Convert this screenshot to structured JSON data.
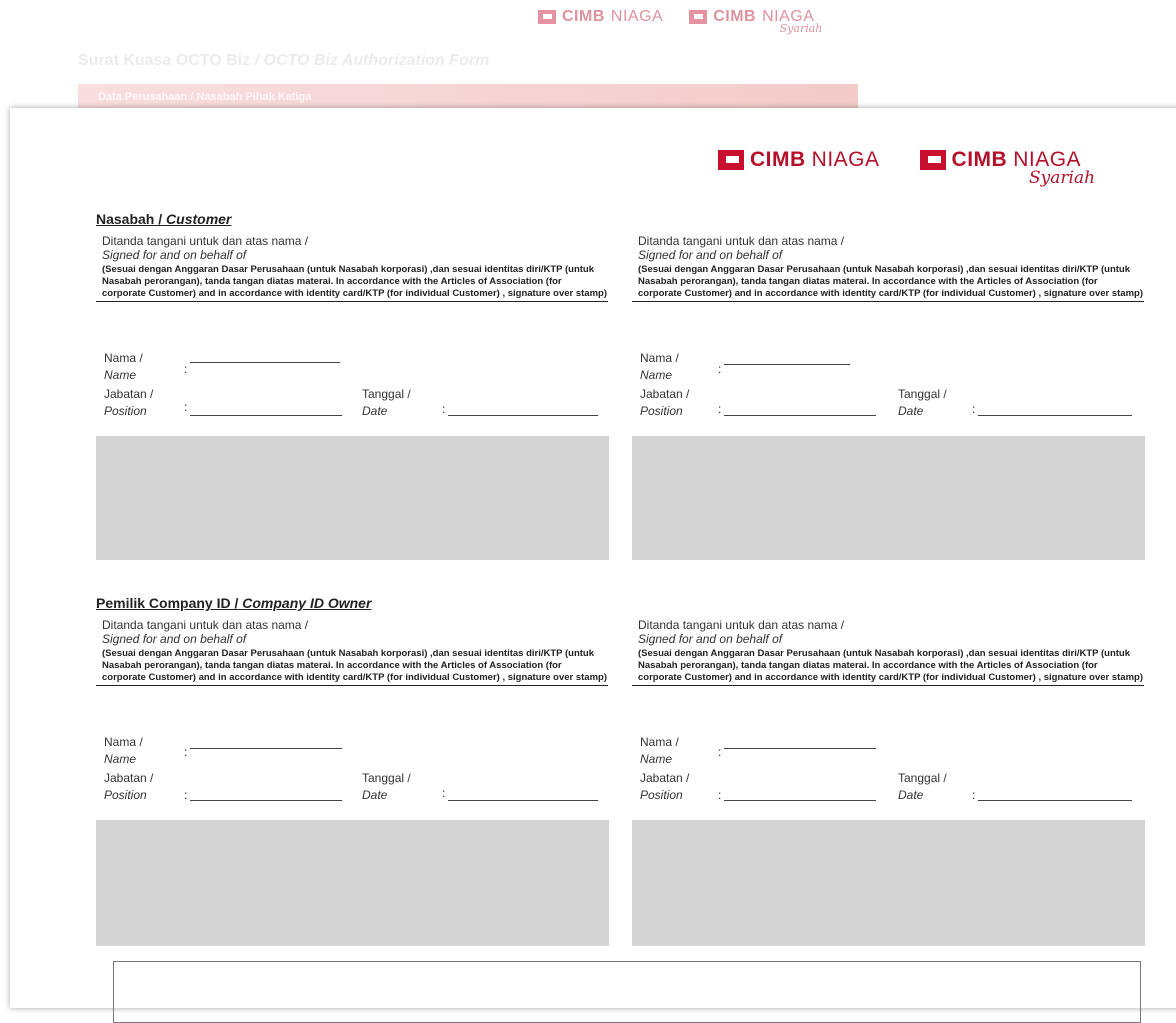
{
  "background_doc": {
    "logo_primary": {
      "strong": "CIMB",
      "light": "NIAGA"
    },
    "logo_syariah": {
      "strong": "CIMB",
      "light": "NIAGA",
      "script": "Syariah"
    },
    "title_id": "Surat Kuasa OCTO Biz",
    "title_en": "/ OCTO Biz Authorization Form",
    "bar_text": "Data Perusahaan / Nasabah Pihak Ketiga"
  },
  "logos": {
    "primary": {
      "strong": "CIMB",
      "light": "NIAGA"
    },
    "syariah": {
      "strong": "CIMB",
      "light": "NIAGA",
      "script": "Syariah"
    }
  },
  "brand_color": "#c8102e",
  "sections": [
    {
      "title_id": "Nasabah / ",
      "title_en": "Customer"
    },
    {
      "title_id": "Pemilik Company ID / ",
      "title_en": "Company ID Owner"
    }
  ],
  "signature_block": {
    "signed_id": "Ditanda tangani untuk dan atas nama /",
    "signed_en": "Signed for and on behalf of",
    "note": "(Sesuai dengan Anggaran Dasar Perusahaan (untuk Nasabah korporasi) ,dan sesuai identitas diri/KTP (untuk Nasabah perorangan), tanda tangan diatas materai. In accordance with the Articles of Association (for corporate Customer) and in accordance with identity card/KTP (for individual Customer) , signature over stamp)",
    "name_id": "Nama /",
    "name_en": "Name",
    "position_id": "Jabatan /",
    "position_en": "Position",
    "date_id": "Tanggal /",
    "date_en": "Date",
    "colon": ":"
  }
}
